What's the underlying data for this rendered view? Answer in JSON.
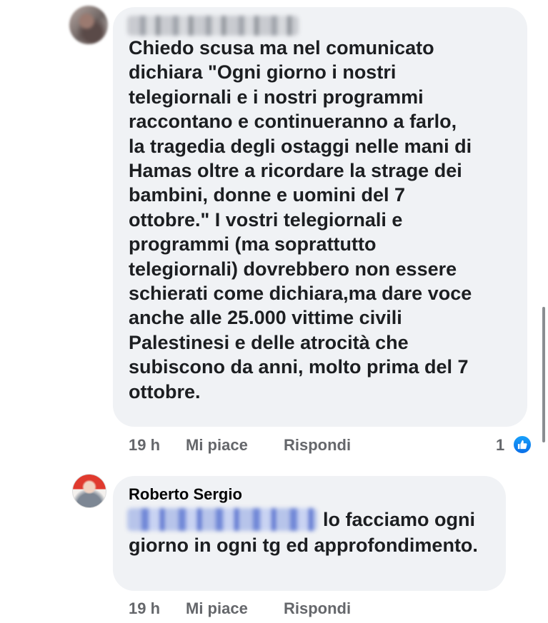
{
  "comment": {
    "text": "Chiedo scusa ma nel comunicato\ndichiara \"Ogni giorno i nostri\ntelegiornali e i nostri programmi\nraccontano e continueranno a farlo,\nla tragedia degli ostaggi nelle mani di\nHamas oltre a ricordare la strage dei\nbambini, donne e uomini del 7\nottobre.\" I vostri telegiornali e\nprogrammi (ma soprattutto\ntelegiornali) dovrebbero non essere\nschierati come dichiara,ma dare voce\nanche alle 25.000 vittime civili\nPalestinesi e delle atrocità che\nsubiscono da anni, molto prima del 7\nottobre.",
    "time": "19 h",
    "like_label": "Mi piace",
    "reply_label": "Rispondi",
    "reaction_count": "1",
    "reaction_icon": "like-thumb-icon",
    "reaction_color": "#1877f2"
  },
  "reply": {
    "author": "Roberto Sergio",
    "text": "lo facciamo ogni giorno in ogni tg ed approfondimento.",
    "time": "19 h",
    "like_label": "Mi piace",
    "reply_label": "Rispondi"
  },
  "colors": {
    "bubble": "#f0f2f5",
    "meta_text": "#65676b",
    "body_text": "#1c1e21"
  }
}
